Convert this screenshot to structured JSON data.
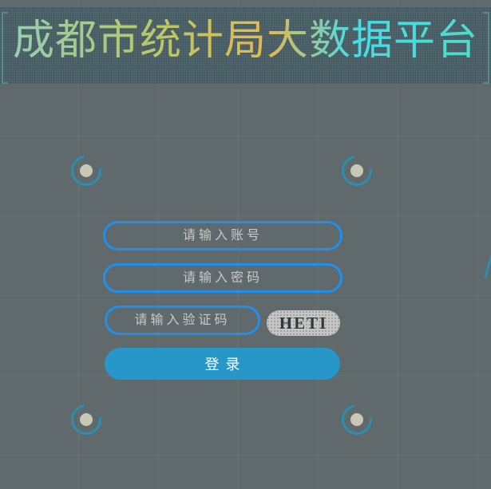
{
  "header": {
    "title": "成都市统计局大数据平台"
  },
  "login_form": {
    "username_placeholder": "请输入账号",
    "password_placeholder": "请输入密码",
    "captcha_placeholder": "请输入验证码",
    "captcha_text": "HETI",
    "login_label": "登录"
  },
  "colors": {
    "background": "#606a6c",
    "input_border": "#1e90ee",
    "button": "#2697c8",
    "orb_ring": "#2a8fb0"
  },
  "icons": [
    "loading-orb-icon",
    "loading-orb-icon",
    "loading-orb-icon",
    "loading-orb-icon"
  ]
}
